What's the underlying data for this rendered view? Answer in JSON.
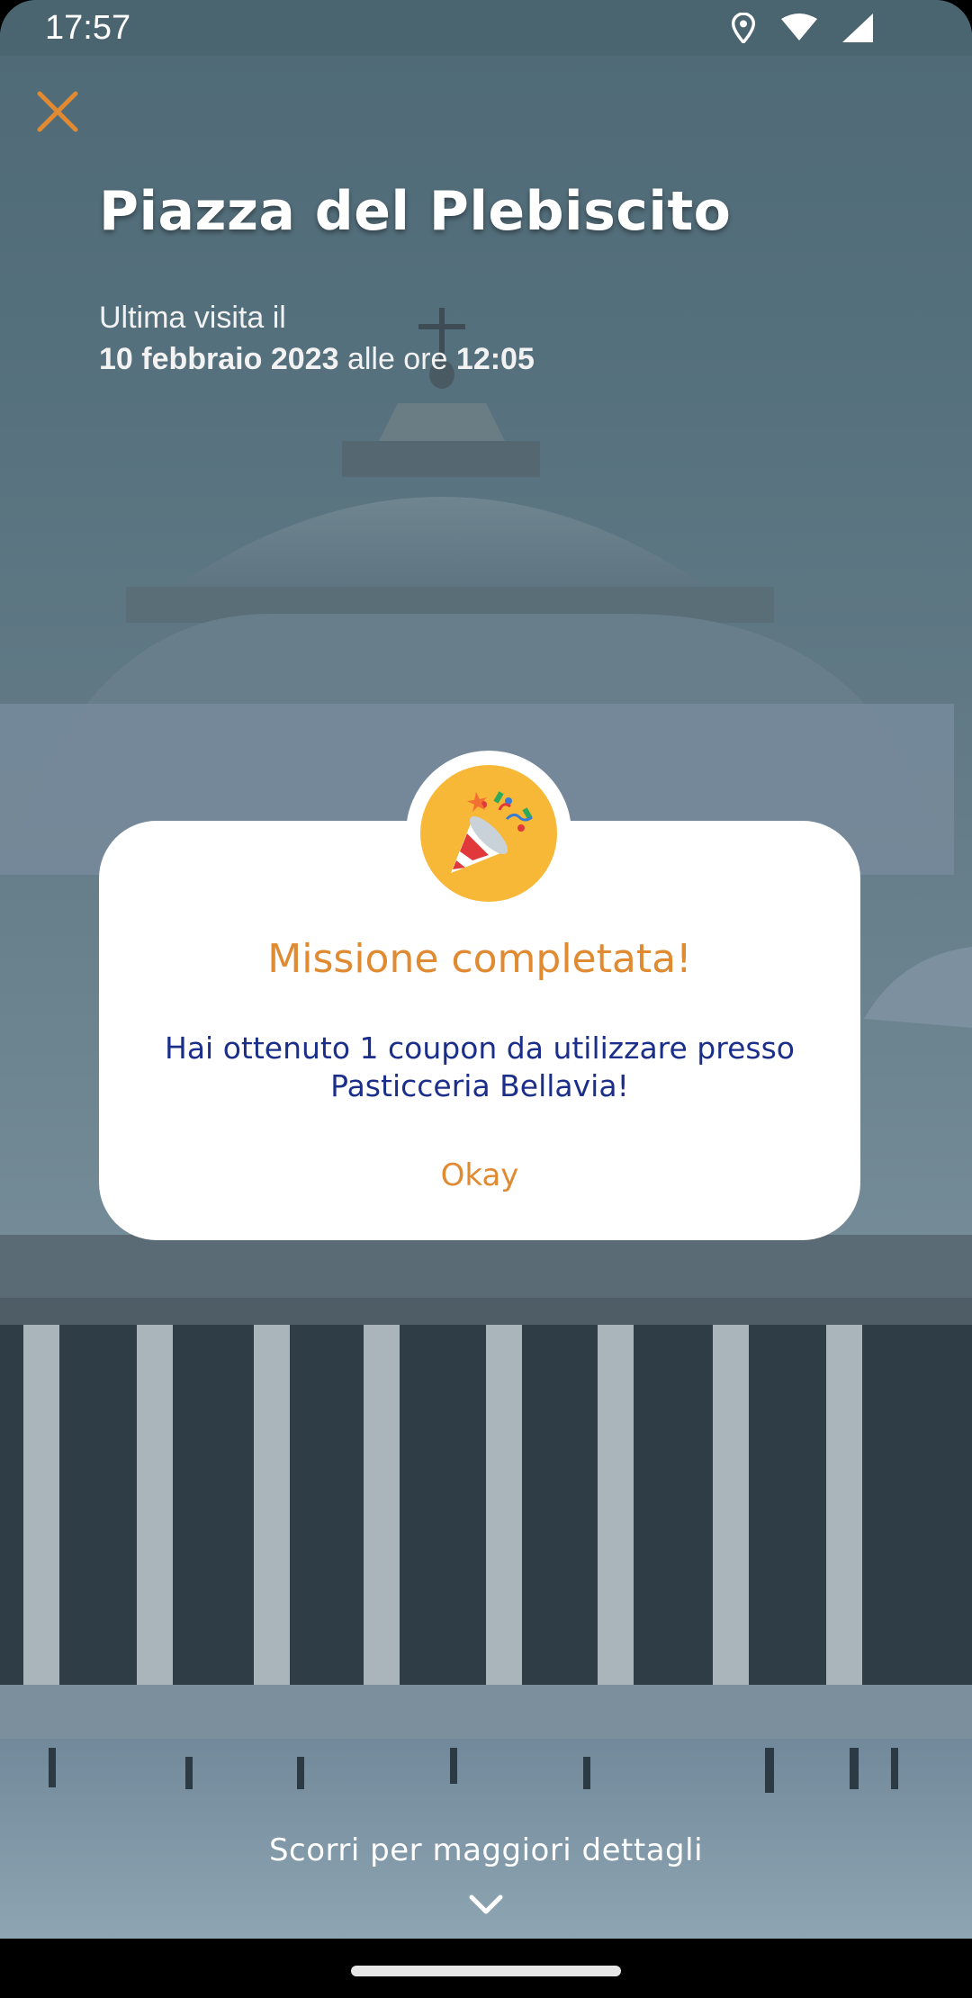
{
  "status_bar": {
    "time": "17:57",
    "icons": [
      "location-icon",
      "wifi-icon",
      "signal-icon"
    ]
  },
  "header": {
    "close_icon": "close-icon",
    "title": "Piazza del Plebiscito",
    "last_visit_prefix": "Ultima visita il",
    "last_visit_date": "10 febbraio 2023",
    "last_visit_middle": "alle ore",
    "last_visit_time": "12:05"
  },
  "modal": {
    "icon": "party-popper-icon",
    "title": "Missione completata!",
    "message": "Hai ottenuto 1 coupon da utilizzare presso Pasticceria Bellavia!",
    "ok_label": "Okay"
  },
  "footer": {
    "scroll_hint": "Scorri per maggiori dettagli",
    "chevron_icon": "chevron-down-icon"
  },
  "colors": {
    "accent": "#e08a32",
    "message": "#1b2f8a",
    "badge": "#f7b838"
  }
}
